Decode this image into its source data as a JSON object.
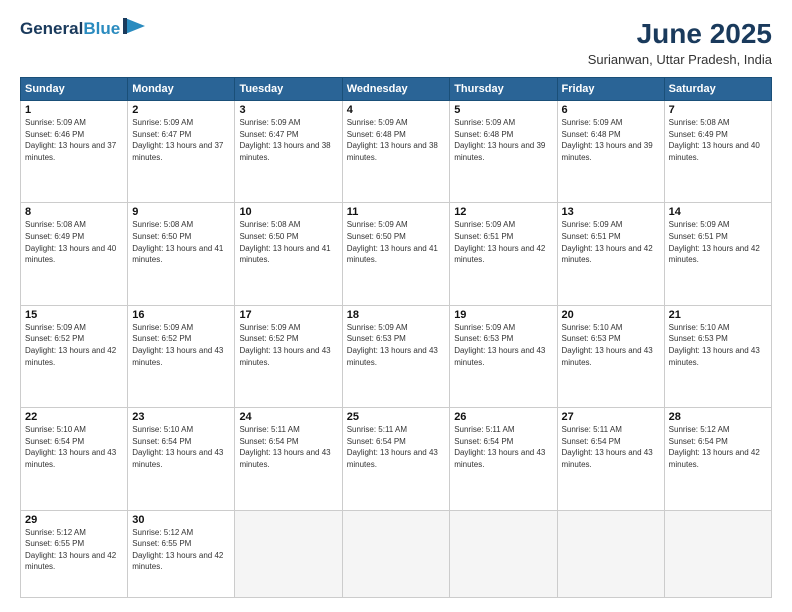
{
  "logo": {
    "line1": "General",
    "line2": "Blue"
  },
  "title": "June 2025",
  "subtitle": "Surianwan, Uttar Pradesh, India",
  "weekdays": [
    "Sunday",
    "Monday",
    "Tuesday",
    "Wednesday",
    "Thursday",
    "Friday",
    "Saturday"
  ],
  "days": [
    {
      "num": "1",
      "sunrise": "5:09 AM",
      "sunset": "6:46 PM",
      "daylight": "13 hours and 37 minutes."
    },
    {
      "num": "2",
      "sunrise": "5:09 AM",
      "sunset": "6:47 PM",
      "daylight": "13 hours and 37 minutes."
    },
    {
      "num": "3",
      "sunrise": "5:09 AM",
      "sunset": "6:47 PM",
      "daylight": "13 hours and 38 minutes."
    },
    {
      "num": "4",
      "sunrise": "5:09 AM",
      "sunset": "6:48 PM",
      "daylight": "13 hours and 38 minutes."
    },
    {
      "num": "5",
      "sunrise": "5:09 AM",
      "sunset": "6:48 PM",
      "daylight": "13 hours and 39 minutes."
    },
    {
      "num": "6",
      "sunrise": "5:09 AM",
      "sunset": "6:48 PM",
      "daylight": "13 hours and 39 minutes."
    },
    {
      "num": "7",
      "sunrise": "5:08 AM",
      "sunset": "6:49 PM",
      "daylight": "13 hours and 40 minutes."
    },
    {
      "num": "8",
      "sunrise": "5:08 AM",
      "sunset": "6:49 PM",
      "daylight": "13 hours and 40 minutes."
    },
    {
      "num": "9",
      "sunrise": "5:08 AM",
      "sunset": "6:50 PM",
      "daylight": "13 hours and 41 minutes."
    },
    {
      "num": "10",
      "sunrise": "5:08 AM",
      "sunset": "6:50 PM",
      "daylight": "13 hours and 41 minutes."
    },
    {
      "num": "11",
      "sunrise": "5:09 AM",
      "sunset": "6:50 PM",
      "daylight": "13 hours and 41 minutes."
    },
    {
      "num": "12",
      "sunrise": "5:09 AM",
      "sunset": "6:51 PM",
      "daylight": "13 hours and 42 minutes."
    },
    {
      "num": "13",
      "sunrise": "5:09 AM",
      "sunset": "6:51 PM",
      "daylight": "13 hours and 42 minutes."
    },
    {
      "num": "14",
      "sunrise": "5:09 AM",
      "sunset": "6:51 PM",
      "daylight": "13 hours and 42 minutes."
    },
    {
      "num": "15",
      "sunrise": "5:09 AM",
      "sunset": "6:52 PM",
      "daylight": "13 hours and 42 minutes."
    },
    {
      "num": "16",
      "sunrise": "5:09 AM",
      "sunset": "6:52 PM",
      "daylight": "13 hours and 43 minutes."
    },
    {
      "num": "17",
      "sunrise": "5:09 AM",
      "sunset": "6:52 PM",
      "daylight": "13 hours and 43 minutes."
    },
    {
      "num": "18",
      "sunrise": "5:09 AM",
      "sunset": "6:53 PM",
      "daylight": "13 hours and 43 minutes."
    },
    {
      "num": "19",
      "sunrise": "5:09 AM",
      "sunset": "6:53 PM",
      "daylight": "13 hours and 43 minutes."
    },
    {
      "num": "20",
      "sunrise": "5:10 AM",
      "sunset": "6:53 PM",
      "daylight": "13 hours and 43 minutes."
    },
    {
      "num": "21",
      "sunrise": "5:10 AM",
      "sunset": "6:53 PM",
      "daylight": "13 hours and 43 minutes."
    },
    {
      "num": "22",
      "sunrise": "5:10 AM",
      "sunset": "6:54 PM",
      "daylight": "13 hours and 43 minutes."
    },
    {
      "num": "23",
      "sunrise": "5:10 AM",
      "sunset": "6:54 PM",
      "daylight": "13 hours and 43 minutes."
    },
    {
      "num": "24",
      "sunrise": "5:11 AM",
      "sunset": "6:54 PM",
      "daylight": "13 hours and 43 minutes."
    },
    {
      "num": "25",
      "sunrise": "5:11 AM",
      "sunset": "6:54 PM",
      "daylight": "13 hours and 43 minutes."
    },
    {
      "num": "26",
      "sunrise": "5:11 AM",
      "sunset": "6:54 PM",
      "daylight": "13 hours and 43 minutes."
    },
    {
      "num": "27",
      "sunrise": "5:11 AM",
      "sunset": "6:54 PM",
      "daylight": "13 hours and 43 minutes."
    },
    {
      "num": "28",
      "sunrise": "5:12 AM",
      "sunset": "6:54 PM",
      "daylight": "13 hours and 42 minutes."
    },
    {
      "num": "29",
      "sunrise": "5:12 AM",
      "sunset": "6:55 PM",
      "daylight": "13 hours and 42 minutes."
    },
    {
      "num": "30",
      "sunrise": "5:12 AM",
      "sunset": "6:55 PM",
      "daylight": "13 hours and 42 minutes."
    }
  ]
}
